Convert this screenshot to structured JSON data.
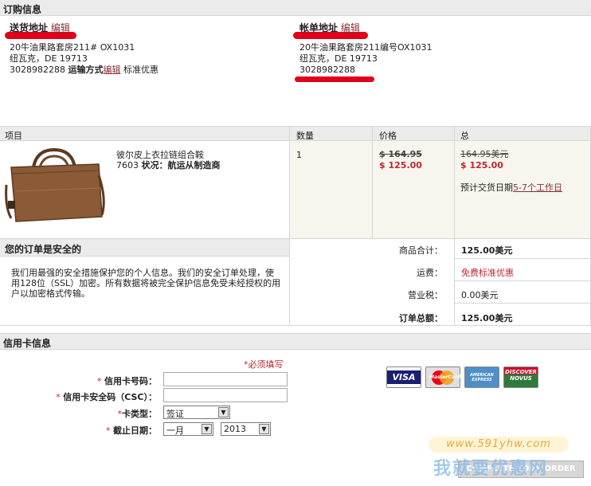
{
  "order_info": {
    "title": "订购信息",
    "shipping": {
      "heading": "送货地址",
      "edit": "编辑",
      "line1": "20牛油果路套房211# OX1031",
      "line2": "纽瓦克，DE 19713",
      "phone": "3028982288",
      "method_label": "运输方式",
      "method_edit": "编辑",
      "method_value": "标准优惠"
    },
    "billing": {
      "heading": "帐单地址",
      "edit": "编辑",
      "line1": "20牛油果路套房211编号OX1031",
      "line2": "纽瓦克，DE 19713",
      "phone": "3028982288"
    }
  },
  "items_table": {
    "headers": [
      "项目",
      "数量",
      "价格",
      "总"
    ],
    "item": {
      "name": "彼尔皮上衣拉链组合鞍",
      "sku": "7603",
      "status_label": "状况：",
      "status_value": "航运从制造商",
      "qty": "1",
      "old_price": "$ 164.95",
      "price": "$ 125.00",
      "old_total": "164.95美元",
      "total": "$ 125.00",
      "delivery_label": "预计交货日期",
      "delivery_value": "5-7个工作日"
    }
  },
  "security": {
    "title": "您的订单是安全的",
    "text": "我们用最强的安全措施保护您的个人信息。我们的安全订单处理，使用128位（SSL）加密。所有数据将被完全保护信息免受未经授权的用户以加密格式传输。"
  },
  "totals": {
    "subtotal_label": "商品合计：",
    "subtotal_value": "125.00美元",
    "shipping_label": "运费：",
    "shipping_value": "免费标准优惠",
    "tax_label": "营业税：",
    "tax_value": "0.00美元",
    "grand_label": "订单总额：",
    "grand_value": "125.00美元"
  },
  "credit_card": {
    "title": "信用卡信息",
    "required_note": "*必须填写",
    "number_label": "信用卡号码：",
    "csc_label": "信用卡安全码（CSC）：",
    "type_label": "卡类型：",
    "type_value": "签证",
    "expiry_label": "截止日期：",
    "month_value": "一月",
    "year_value": "2013",
    "cards": [
      "VISA",
      "MasterCard",
      "AMERICAN EXPRESS",
      "DISCOVER NOVUS"
    ]
  },
  "complete_button": "COMPLETE YOUR ORDER",
  "watermark": {
    "url": "www.591yhw.com",
    "text": "我就要优惠网"
  },
  "colors": {
    "accent_red": "#c0262f",
    "bar_grey": "#ebebeb",
    "cell_tint": "#f6f6ef"
  }
}
